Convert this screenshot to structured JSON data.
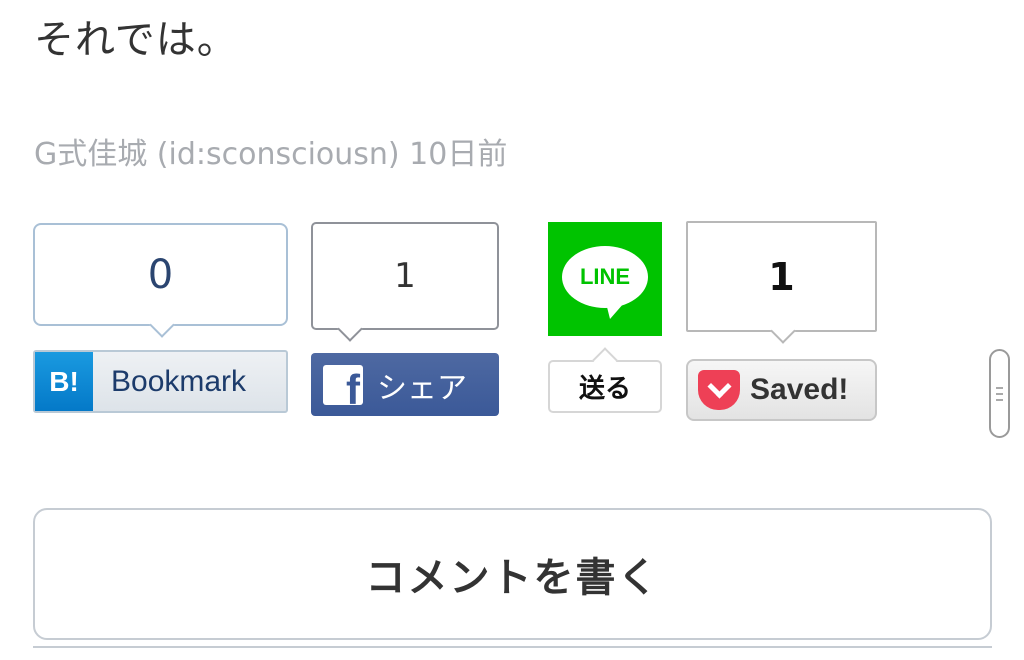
{
  "post": {
    "closing_text": "それでは。",
    "meta": "G式佳城 (id:sconsciousn) 10日前"
  },
  "share": {
    "hatena": {
      "count": "0",
      "label": "Bookmark",
      "logo": "B!",
      "icon": "hatena-bookmark-icon",
      "color": "#1a9ae0"
    },
    "facebook": {
      "count": "1",
      "label": "シェア",
      "icon": "facebook-icon",
      "color": "#3b5998"
    },
    "line": {
      "logo": "LINE",
      "label": "送る",
      "icon": "line-icon",
      "color": "#00c300"
    },
    "pocket": {
      "count": "1",
      "label": "Saved!",
      "icon": "pocket-icon",
      "color": "#ee4056"
    }
  },
  "comment": {
    "button_label": "コメントを書く"
  }
}
